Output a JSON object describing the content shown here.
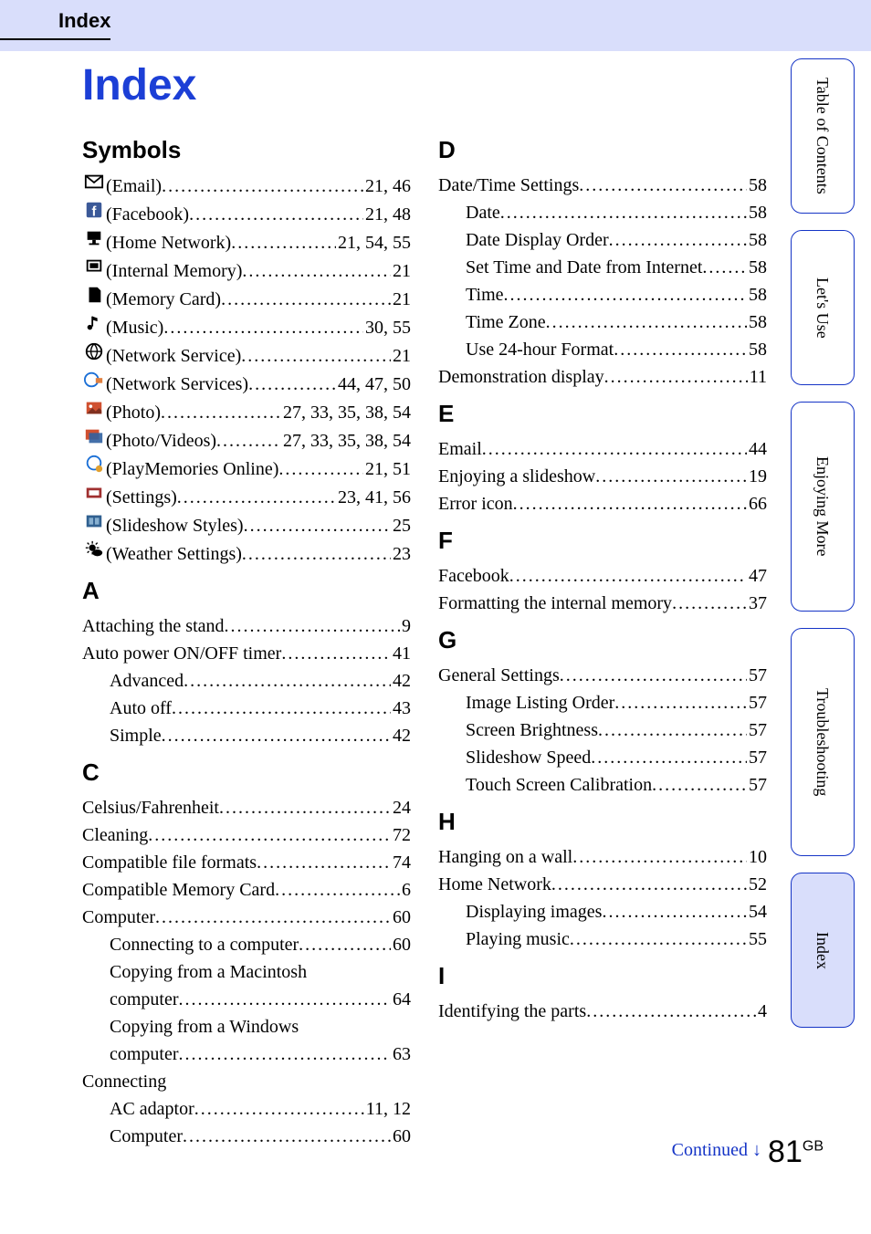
{
  "breadcrumb": "Index",
  "title": "Index",
  "continued": "Continued ↓",
  "page_number": "81",
  "page_suffix": "GB",
  "tabs": {
    "toc": "Table of\nContents",
    "use": "Let's Use",
    "more": "Enjoying More",
    "trouble": "Troubleshooting",
    "index": "Index"
  },
  "col1": {
    "symbols": "Symbols",
    "s_email_lbl": "(Email)",
    "s_email_pg": "21, 46",
    "s_fb_lbl": "(Facebook)",
    "s_fb_pg": "21, 48",
    "s_home_lbl": "(Home Network)",
    "s_home_pg": "21, 54, 55",
    "s_intmem_lbl": "(Internal Memory)",
    "s_intmem_pg": "21",
    "s_mcard_lbl": "(Memory Card)",
    "s_mcard_pg": "21",
    "s_music_lbl": "(Music)",
    "s_music_pg": "30, 55",
    "s_netsvc_lbl": "(Network Service)",
    "s_netsvc_pg": "21",
    "s_netsvcs_lbl": "(Network Services)",
    "s_netsvcs_pg": "44, 47, 50",
    "s_photo_lbl": "(Photo)",
    "s_photo_pg": "27, 33, 35, 38, 54",
    "s_photovid_lbl": "(Photo/Videos)",
    "s_photovid_pg": "27, 33, 35, 38, 54",
    "s_playmem_lbl": "(PlayMemories Online)",
    "s_playmem_pg": "21, 51",
    "s_settings_lbl": "(Settings)",
    "s_settings_pg": "23, 41, 56",
    "s_slides_lbl": "(Slideshow Styles)",
    "s_slides_pg": "25",
    "s_weather_lbl": "(Weather Settings)",
    "s_weather_pg": "23",
    "a_head": "A",
    "a_attach_lbl": "Attaching the stand",
    "a_attach_pg": "9",
    "a_auto_lbl": "Auto power ON/OFF timer",
    "a_auto_pg": "41",
    "a_adv_lbl": "Advanced",
    "a_adv_pg": "42",
    "a_off_lbl": "Auto off",
    "a_off_pg": "43",
    "a_simple_lbl": "Simple",
    "a_simple_pg": "42",
    "c_head": "C",
    "c_cf_lbl": "Celsius/Fahrenheit",
    "c_cf_pg": "24",
    "c_clean_lbl": "Cleaning",
    "c_clean_pg": "72",
    "c_cff_lbl": "Compatible file formats",
    "c_cff_pg": "74",
    "c_cmc_lbl": "Compatible Memory Card",
    "c_cmc_pg": "6",
    "c_comp_lbl": "Computer",
    "c_comp_pg": "60",
    "c_conn_lbl": "Connecting to a computer",
    "c_conn_pg": "60",
    "c_mac_lbl1": "Copying from a Macintosh",
    "c_mac_lbl2": "computer",
    "c_mac_pg": "64",
    "c_win_lbl1": "Copying from a Windows",
    "c_win_lbl2": "computer",
    "c_win_pg": "63",
    "c_connecting_lbl": "Connecting",
    "c_ac_lbl": "AC adaptor",
    "c_ac_pg": "11, 12",
    "c_comp2_lbl": "Computer",
    "c_comp2_pg": "60"
  },
  "col2": {
    "d_head": "D",
    "d_dt_lbl": "Date/Time Settings",
    "d_dt_pg": "58",
    "d_date_lbl": "Date",
    "d_date_pg": "58",
    "d_ddo_lbl": "Date Display Order",
    "d_ddo_pg": "58",
    "d_set_lbl": "Set Time and Date from Internet",
    "d_set_pg": "58",
    "d_time_lbl": "Time",
    "d_time_pg": "58",
    "d_tz_lbl": "Time Zone",
    "d_tz_pg": "58",
    "d_24h_lbl": "Use 24-hour Format",
    "d_24h_pg": "58",
    "d_demo_lbl": "Demonstration display",
    "d_demo_pg": "11",
    "e_head": "E",
    "e_email_lbl": "Email",
    "e_email_pg": "44",
    "e_enj_lbl": "Enjoying a slideshow",
    "e_enj_pg": "19",
    "e_err_lbl": "Error icon",
    "e_err_pg": "66",
    "f_head": "F",
    "f_fb_lbl": "Facebook",
    "f_fb_pg": "47",
    "f_fmt_lbl": "Formatting the internal memory",
    "f_fmt_pg": "37",
    "g_head": "G",
    "g_gs_lbl": "General Settings",
    "g_gs_pg": "57",
    "g_ilo_lbl": "Image Listing Order",
    "g_ilo_pg": "57",
    "g_sb_lbl": "Screen Brightness",
    "g_sb_pg": "57",
    "g_ss_lbl": "Slideshow Speed",
    "g_ss_pg": "57",
    "g_tsc_lbl": "Touch Screen Calibration",
    "g_tsc_pg": "57",
    "h_head": "H",
    "h_hang_lbl": "Hanging on a wall",
    "h_hang_pg": "10",
    "h_hn_lbl": "Home Network",
    "h_hn_pg": "52",
    "h_di_lbl": "Displaying images",
    "h_di_pg": "54",
    "h_pm_lbl": "Playing music",
    "h_pm_pg": "55",
    "i_head": "I",
    "i_id_lbl": "Identifying the parts",
    "i_id_pg": "4"
  }
}
